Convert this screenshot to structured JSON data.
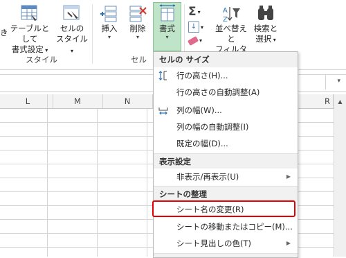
{
  "ribbon": {
    "partial_left": "き",
    "table_format": {
      "line1": "テーブルとして",
      "line2": "書式設定"
    },
    "cell_style": {
      "line1": "セルの",
      "line2": "スタイル"
    },
    "insert": "挿入",
    "delete": "削除",
    "format": "書式",
    "sort_filter": {
      "line1": "並べ替えと",
      "line2": "フィルター"
    },
    "find_select": {
      "line1": "検索と",
      "line2": "選択"
    },
    "groups": {
      "style": "スタイル",
      "cells": "セル"
    },
    "icons": [
      "table-format-icon",
      "cell-style-icon",
      "insert-icon",
      "delete-icon",
      "format-icon",
      "sigma-icon",
      "fill-icon",
      "eraser-icon",
      "sort-filter-icon",
      "binoculars-icon"
    ]
  },
  "columns": [
    "L",
    "M",
    "N",
    "R"
  ],
  "menu": {
    "section1": "セルの サイズ",
    "row_height": "行の高さ(H)...",
    "autofit_row": "行の高さの自動調整(A)",
    "col_width": "列の幅(W)...",
    "autofit_col": "列の幅の自動調整(I)",
    "default_width": "既定の幅(D)...",
    "section2": "表示設定",
    "hide_unhide": "非表示/再表示(U)",
    "section3": "シートの整理",
    "rename_sheet": "シート名の変更(R)",
    "move_copy": "シートの移動またはコピー(M)...",
    "tab_color": "シート見出しの色(T)",
    "section4_partial": "保護"
  },
  "colors": {
    "highlight": "#e50000",
    "active_button": "#bfe4c7"
  }
}
